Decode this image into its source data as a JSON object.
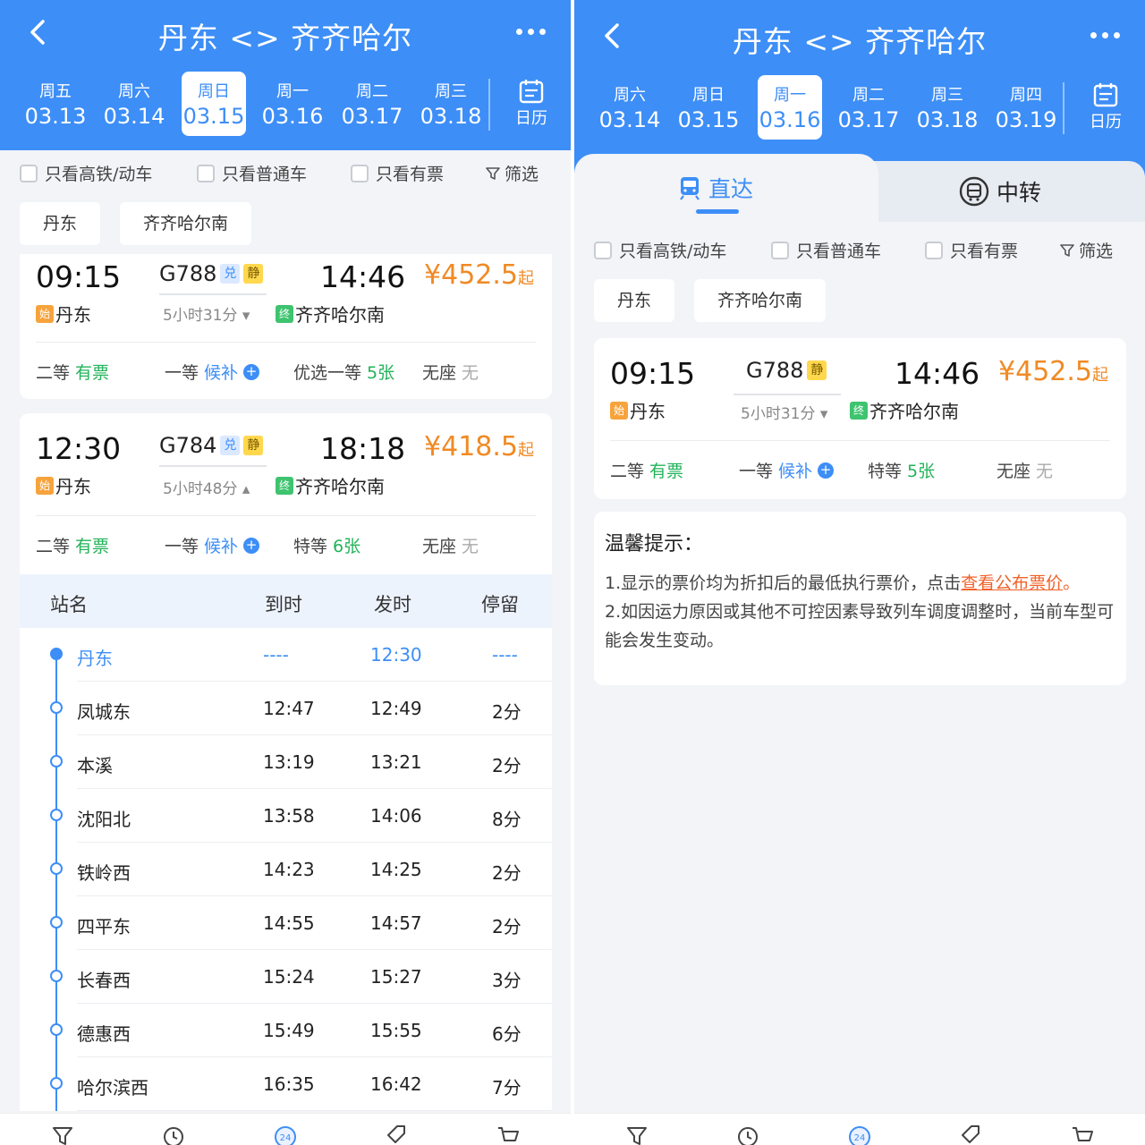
{
  "left": {
    "title": "丹东 <> 齐齐哈尔",
    "dates": [
      {
        "weekday": "周五",
        "date": "03.13",
        "selected": false
      },
      {
        "weekday": "周六",
        "date": "03.14",
        "selected": false
      },
      {
        "weekday": "周日",
        "date": "03.15",
        "selected": true
      },
      {
        "weekday": "周一",
        "date": "03.16",
        "selected": false
      },
      {
        "weekday": "周二",
        "date": "03.17",
        "selected": false
      },
      {
        "weekday": "周三",
        "date": "03.18",
        "selected": false
      }
    ],
    "calendar_label": "日历",
    "filters": {
      "high_speed": "只看高铁/动车",
      "normal": "只看普通车",
      "available": "只看有票",
      "screen": "筛选"
    },
    "station_chips": [
      "丹东",
      "齐齐哈尔南"
    ],
    "trains": [
      {
        "dep_time": "09:15",
        "train_no": "G788",
        "tag_dui": "兑",
        "tag_jing": "静",
        "arr_time": "14:46",
        "price": "¥452.5",
        "price_suffix": "起",
        "start_badge": "始",
        "dep_station": "丹东",
        "duration": "5小时31分",
        "end_badge": "终",
        "arr_station": "齐齐哈尔南",
        "seats": [
          {
            "name": "二等",
            "status": "有票"
          },
          {
            "name": "一等",
            "status": "候补"
          },
          {
            "name": "优选一等",
            "status": "5张"
          },
          {
            "name": "无座",
            "status": "无"
          }
        ]
      },
      {
        "dep_time": "12:30",
        "train_no": "G784",
        "tag_dui": "兑",
        "tag_jing": "静",
        "arr_time": "18:18",
        "price": "¥418.5",
        "price_suffix": "起",
        "start_badge": "始",
        "dep_station": "丹东",
        "duration": "5小时48分",
        "end_badge": "终",
        "arr_station": "齐齐哈尔南",
        "seats": [
          {
            "name": "二等",
            "status": "有票"
          },
          {
            "name": "一等",
            "status": "候补"
          },
          {
            "name": "特等",
            "status": "6张"
          },
          {
            "name": "无座",
            "status": "无"
          }
        ]
      }
    ],
    "stop_table": {
      "headers": {
        "station": "站名",
        "arrive": "到时",
        "depart": "发时",
        "stay": "停留"
      },
      "rows": [
        {
          "station": "丹东",
          "arrive": "----",
          "depart": "12:30",
          "stay": "----"
        },
        {
          "station": "凤城东",
          "arrive": "12:47",
          "depart": "12:49",
          "stay": "2分"
        },
        {
          "station": "本溪",
          "arrive": "13:19",
          "depart": "13:21",
          "stay": "2分"
        },
        {
          "station": "沈阳北",
          "arrive": "13:58",
          "depart": "14:06",
          "stay": "8分"
        },
        {
          "station": "铁岭西",
          "arrive": "14:23",
          "depart": "14:25",
          "stay": "2分"
        },
        {
          "station": "四平东",
          "arrive": "14:55",
          "depart": "14:57",
          "stay": "2分"
        },
        {
          "station": "长春西",
          "arrive": "15:24",
          "depart": "15:27",
          "stay": "3分"
        },
        {
          "station": "德惠西",
          "arrive": "15:49",
          "depart": "15:55",
          "stay": "6分"
        },
        {
          "station": "哈尔滨西",
          "arrive": "16:35",
          "depart": "16:42",
          "stay": "7分"
        }
      ]
    },
    "bottom_nav_badge": "24"
  },
  "right": {
    "title": "丹东 <> 齐齐哈尔",
    "dates": [
      {
        "weekday": "周六",
        "date": "03.14",
        "selected": false
      },
      {
        "weekday": "周日",
        "date": "03.15",
        "selected": false
      },
      {
        "weekday": "周一",
        "date": "03.16",
        "selected": true
      },
      {
        "weekday": "周二",
        "date": "03.17",
        "selected": false
      },
      {
        "weekday": "周三",
        "date": "03.18",
        "selected": false
      },
      {
        "weekday": "周四",
        "date": "03.19",
        "selected": false
      }
    ],
    "calendar_label": "日历",
    "tabs": {
      "direct": "直达",
      "transfer": "中转"
    },
    "filters": {
      "high_speed": "只看高铁/动车",
      "normal": "只看普通车",
      "available": "只看有票",
      "screen": "筛选"
    },
    "station_chips": [
      "丹东",
      "齐齐哈尔南"
    ],
    "train": {
      "dep_time": "09:15",
      "train_no": "G788",
      "tag_jing": "静",
      "arr_time": "14:46",
      "price": "¥452.5",
      "price_suffix": "起",
      "start_badge": "始",
      "dep_station": "丹东",
      "duration": "5小时31分",
      "end_badge": "终",
      "arr_station": "齐齐哈尔南",
      "seats": [
        {
          "name": "二等",
          "status": "有票"
        },
        {
          "name": "一等",
          "status": "候补"
        },
        {
          "name": "特等",
          "status": "5张"
        },
        {
          "name": "无座",
          "status": "无"
        }
      ]
    },
    "tips": {
      "title": "温馨提示：",
      "line1_prefix": "1.显示的票价均为折扣后的最低执行票价，点击",
      "line1_link": "查看公布票价",
      "line1_suffix": "。",
      "line2": "2.如因运力原因或其他不可控因素导致列车调度调整时，当前车型可能会发生变动。"
    },
    "bottom_nav_badge": "24"
  },
  "colors": {
    "brand_blue": "#3d8ef7",
    "price_orange": "#f08a24",
    "available_green": "#22b35a",
    "link_red": "#f0622a"
  }
}
